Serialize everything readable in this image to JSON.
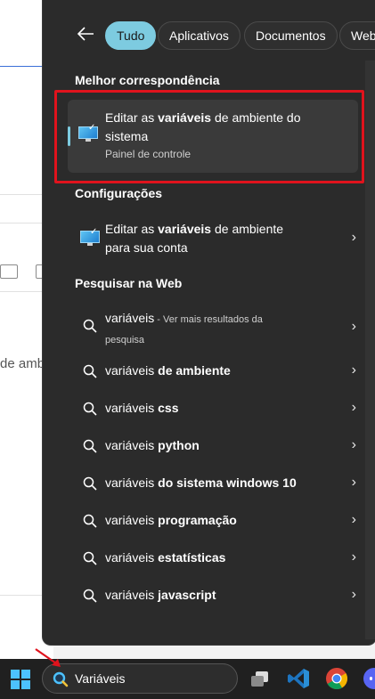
{
  "background_app": {
    "partial_text": "de amb"
  },
  "panel": {
    "filters": [
      {
        "label": "Tudo",
        "active": true
      },
      {
        "label": "Aplicativos",
        "active": false
      },
      {
        "label": "Documentos",
        "active": false
      },
      {
        "label": "Web",
        "active": false
      }
    ],
    "best_match": {
      "section_title": "Melhor correspondência",
      "title_before": "Editar as ",
      "title_bold": "variáveis",
      "title_after": " de ambiente do",
      "title_line2": "sistema",
      "subtitle": "Painel de controle"
    },
    "settings": {
      "section_title": "Configurações",
      "item_before": "Editar as ",
      "item_bold": "variáveis",
      "item_after": " de ambiente",
      "item_line2": "para sua conta"
    },
    "web": {
      "section_title": "Pesquisar na Web",
      "first": {
        "term": "variáveis",
        "suffix": " - Ver mais resultados da",
        "suffix_line2": "pesquisa"
      },
      "items": [
        {
          "prefix": "variáveis ",
          "bold": "de ambiente"
        },
        {
          "prefix": "variáveis ",
          "bold": "css"
        },
        {
          "prefix": "variáveis ",
          "bold": "python"
        },
        {
          "prefix": "variáveis ",
          "bold": "do sistema windows 10"
        },
        {
          "prefix": "variáveis ",
          "bold": "programação"
        },
        {
          "prefix": "variáveis ",
          "bold": "estatísticas"
        },
        {
          "prefix": "variáveis ",
          "bold": "javascript"
        }
      ]
    }
  },
  "taskbar": {
    "search_value": "Variáveis",
    "icons": [
      "windows-start-icon",
      "search-icon",
      "task-view-icon",
      "vscode-icon",
      "chrome-icon",
      "discord-icon"
    ]
  },
  "colors": {
    "accent": "#7dcbe0",
    "highlight_box": "#e0131d",
    "panel_bg": "#2b2b2b"
  }
}
